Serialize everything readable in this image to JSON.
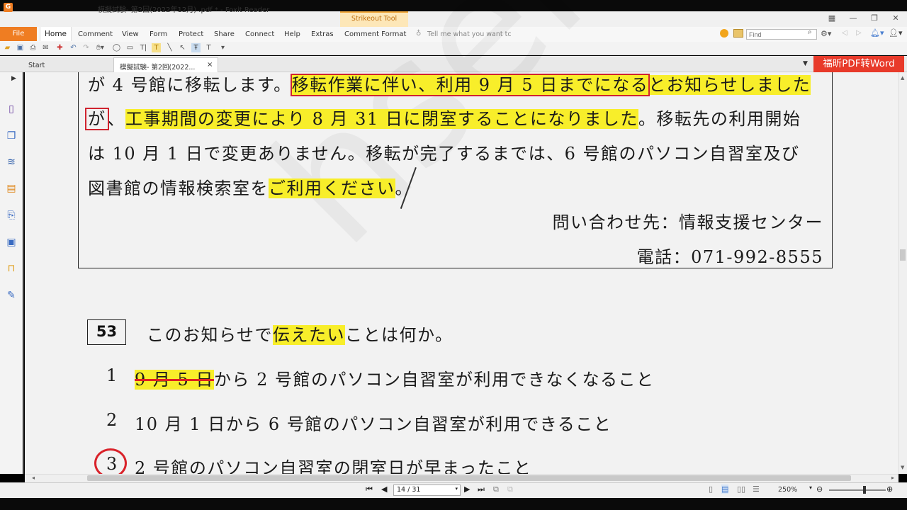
{
  "window": {
    "title": "模擬試験- 第2回(2022年12月) .pdf * - Foxit Reader",
    "context_tab": "Strikeout Tool"
  },
  "menu": {
    "file": "File",
    "items": [
      "Home",
      "Comment",
      "View",
      "Form",
      "Protect",
      "Share",
      "Connect",
      "Help",
      "Extras",
      "Comment Format"
    ],
    "tell_me": "Tell me what you want tc",
    "find_placeholder": "Find"
  },
  "tabs": {
    "start": "Start",
    "document": "模擬試験- 第2回(2022...",
    "close": "×"
  },
  "convert_button": "福昕PDF转Word",
  "document": {
    "line1_plain": "が 4 号館に移転します。",
    "line1_boxed": "移転作業に伴い、利用 9 月 5 日までになる",
    "line1_hl": "とお知らせしました",
    "line2_boxed": "が",
    "line2_plain1": "、",
    "line2_hl": "工事期間の変更により 8 月 31 日に閉室することになりました",
    "line2_plain2": "。移転先の利用開始",
    "line3": "は 10 月 1 日で変更ありません。移転が完了するまでは、6 号館のパソコン自習室及び",
    "line4_plain": "図書館の情報検索室を",
    "line4_hl": "ご利用ください",
    "line4_end": "。",
    "contact": "問い合わせ先：情報支援センター",
    "phone": "電話：071-992-8555",
    "question_number": "53",
    "question_plain1": "このお知らせで",
    "question_hl": "伝えたい",
    "question_plain2": "ことは何か。",
    "options": [
      {
        "num": "1",
        "struck": "9 月 5 日",
        "text": "から 2 号館のパソコン自習室が利用できなくなること"
      },
      {
        "num": "2",
        "struck": "",
        "text": "10 月 1 日から 6 号館のパソコン自習室が利用できること"
      },
      {
        "num": "3",
        "struck": "",
        "text": "2 号館のパソコン自習室の閉室日が早まったこと"
      }
    ],
    "watermark": "hsense"
  },
  "status": {
    "page": "14 / 31",
    "zoom": "250%"
  },
  "colors": {
    "accent": "#ef7d22",
    "highlight": "#f8ee2a",
    "annotation_red": "#d9222a",
    "convert_red": "#e83a2a"
  }
}
